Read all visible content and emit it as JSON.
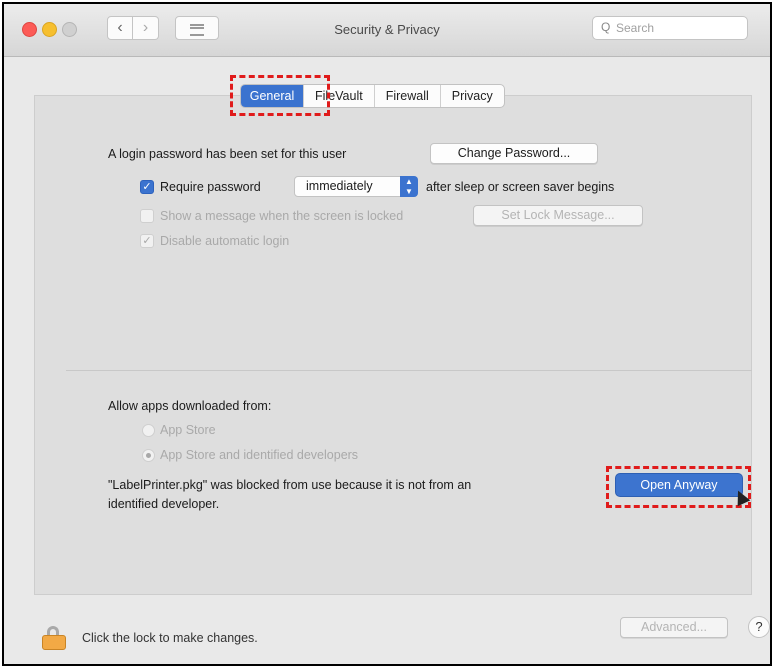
{
  "window": {
    "title": "Security & Privacy"
  },
  "toolbar": {
    "back_icon": "‹",
    "forward_icon": "›",
    "search_placeholder": "Search",
    "search_icon": "Q"
  },
  "tabs": [
    {
      "label": "General",
      "active": true
    },
    {
      "label": "FileVault",
      "active": false
    },
    {
      "label": "Firewall",
      "active": false
    },
    {
      "label": "Privacy",
      "active": false
    }
  ],
  "general": {
    "login_text": "A login password has been set for this user",
    "change_password_label": "Change Password...",
    "require_password_label": "Require password",
    "require_password_value": "immediately",
    "after_sleep_text": "after sleep or screen saver begins",
    "show_message_label": "Show a message when the screen is locked",
    "set_lock_message_label": "Set Lock Message...",
    "disable_login_label": "Disable automatic login"
  },
  "allow_apps": {
    "heading": "Allow apps downloaded from:",
    "options": [
      {
        "label": "App Store",
        "selected": false
      },
      {
        "label": "App Store and identified developers",
        "selected": true
      }
    ],
    "blocked_line1": "\"LabelPrinter.pkg\" was blocked from use because it is not from an",
    "blocked_line2": "identified developer.",
    "open_anyway_label": "Open Anyway"
  },
  "footer": {
    "lock_text": "Click the lock to make changes.",
    "advanced_label": "Advanced...",
    "help_label": "?"
  },
  "colors": {
    "accent": "#3b73cf",
    "highlight": "#e01b1b",
    "lock": "#f2a945"
  }
}
